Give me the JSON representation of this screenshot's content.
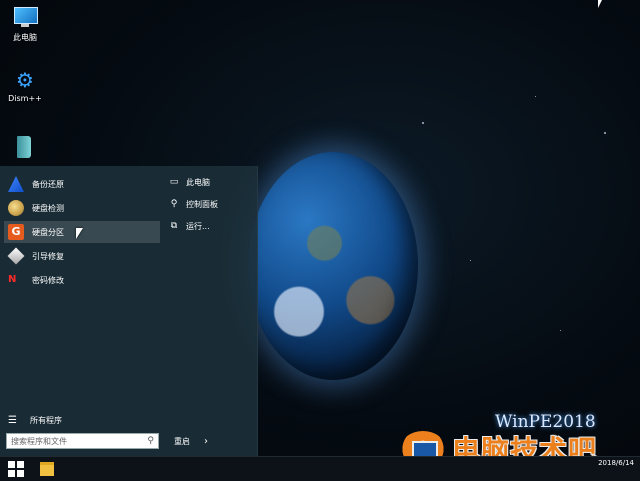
{
  "desktop": {
    "icons": [
      {
        "label": "此电脑",
        "icon": "computer-icon"
      },
      {
        "label": "Dism++",
        "icon": "gears-icon"
      },
      {
        "label": "",
        "icon": "book-icon"
      }
    ],
    "wallpaper_text": "WinPE2018"
  },
  "start_menu": {
    "left_items": [
      {
        "label": "备份还原",
        "icon": "backup-icon"
      },
      {
        "label": "硬盘检测",
        "icon": "disk-check-icon"
      },
      {
        "label": "硬盘分区",
        "icon": "partition-icon"
      },
      {
        "label": "引导修复",
        "icon": "boot-repair-icon"
      },
      {
        "label": "密码修改",
        "icon": "password-icon"
      }
    ],
    "right_items": [
      {
        "label": "此电脑",
        "icon": "laptop-icon"
      },
      {
        "label": "控制面板",
        "icon": "wrench-icon"
      },
      {
        "label": "运行...",
        "icon": "run-icon"
      }
    ],
    "all_programs": "所有程序",
    "search_placeholder": "搜索程序和文件",
    "restart": "重启",
    "partition_glyph": "G",
    "password_glyph": "N"
  },
  "taskbar": {
    "time": "",
    "date": "2018/6/14"
  },
  "watermark": {
    "text": "电脑技术吧"
  },
  "colors": {
    "menu_bg": "#1c303a",
    "partition_orange": "#e55c1e",
    "watermark_orange": "#ff8a1e"
  }
}
